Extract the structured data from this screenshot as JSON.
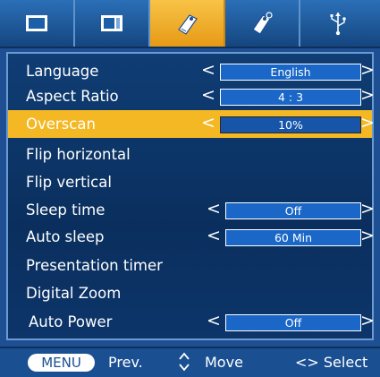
{
  "tabs": [
    {
      "icon": "picture-icon",
      "active": false
    },
    {
      "icon": "screen-icon",
      "active": false
    },
    {
      "icon": "option-tag-icon",
      "active": true
    },
    {
      "icon": "settings-tag-icon",
      "active": false
    },
    {
      "icon": "usb-icon",
      "active": false
    }
  ],
  "menu": {
    "items": [
      {
        "label": "Language",
        "value": "English"
      },
      {
        "label": "Aspect Ratio",
        "value": "4 : 3"
      },
      {
        "label": "Overscan",
        "value": "10%"
      },
      {
        "label": "Flip horizontal"
      },
      {
        "label": "Flip vertical"
      },
      {
        "label": "Sleep time",
        "value": "Off"
      },
      {
        "label": "Auto sleep",
        "value": "60 Min"
      },
      {
        "label": "Presentation timer"
      },
      {
        "label": "Digital Zoom"
      },
      {
        "label": "Auto Power",
        "value": "Off"
      }
    ],
    "left_arrow": "<",
    "right_arrow": ">"
  },
  "footer": {
    "menu_key": "MENU",
    "prev_label": "Prev.",
    "move_label": "Move",
    "select_label": "<> Select"
  },
  "colors": {
    "background": "#1d4f92",
    "highlight": "#f4b824",
    "value_box": "#1a67c7"
  }
}
